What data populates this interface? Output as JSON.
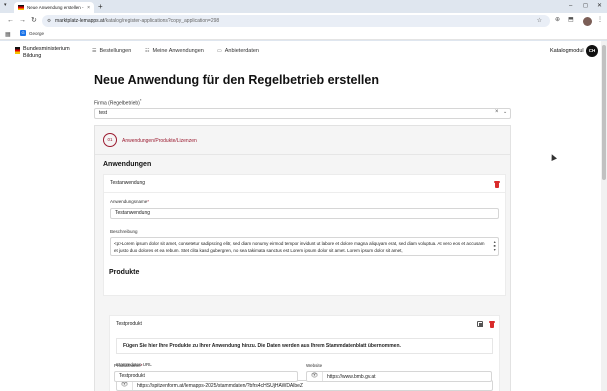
{
  "browser": {
    "tab_title": "Neue Anwendung erstellen - M",
    "tab_close": "×",
    "new_tab": "+",
    "tab_menu": "▾",
    "window_controls": [
      "–",
      "◻",
      "✕"
    ],
    "nav": {
      "back": "←",
      "forward": "→",
      "reload": "↻"
    },
    "site_icon": "⚙",
    "url_host": "marktplatz-lemapps.at",
    "url_path": "/katalog/register-applications?copy_application=298",
    "bookmark_star": "☆",
    "toolbar_icons": [
      "⊕",
      "⬒",
      "⋮"
    ],
    "apps_icon": "▦",
    "bookmark_letter": "G",
    "bookmark_label": "George"
  },
  "header": {
    "logo_line1": "Bundesministerium",
    "logo_line2": "Bildung",
    "nav": [
      {
        "icon": "☰",
        "label": "Bestellungen"
      },
      {
        "icon": "☷",
        "label": "Meine Anwendungen"
      },
      {
        "icon": "▭",
        "label": "Anbieterdaten"
      }
    ],
    "user_label": "Katalogmodul",
    "user_initials": "CH"
  },
  "page": {
    "title": "Neue Anwendung für den Regelbetrieb erstellen",
    "firma_label": "Firma (Regelbetrieb)",
    "required_mark": "*",
    "firma_value": "test",
    "clear_icon": "×",
    "chevron_icon": "⌄"
  },
  "stepper": {
    "number": "01",
    "label": "Anwendungen/Produkte/Lizenzen"
  },
  "anwendungen": {
    "heading": "Anwendungen",
    "item_title": "Testanwendung",
    "name_label": "Anwendungsname",
    "name_value": "Testanwendung",
    "desc_label": "Beschreibung",
    "desc_value": "<p>Lorem ipsum dolor sit amet, consetetur sadipscing elitr, sed diam nonumy eirmod tempor invidunt ut labore et dolore magna aliquyam erat, sed diam voluptua. At vero eos et accusam et justo duo dolores et ea rebum. Stet clita kasd gubergren, no sea takimata sanctus est Lorem ipsum dolor sit amet. Lorem ipsum dolor sit amet,",
    "scroll_up": "▲",
    "scroll_thumb": "■",
    "scroll_down": "▼"
  },
  "produkte": {
    "heading": "Produkte",
    "item_title": "Testprodukt",
    "hint": "Fügen Sie hier Ihre Produkte zu Ihrer Anwendung hinzu. Die Daten werden aus Ihrem Stammdatenblatt übernommen.",
    "stamm_label": "Stammdaten URL",
    "stamm_note_pre": "Bitte geben Sie hier Ihre ",
    "stamm_note_link": "Stammdaten URL",
    "stamm_note_post": " aus der Anbieter Zertifizierung an.",
    "stamm_value": "https://spitzenform.at/lemapps-2025/stammdaten/?bfrs4cHSUjHAWDAlbeZ",
    "produktname_label": "Produktname",
    "produktname_value": "Testprodukt",
    "website_label": "Website",
    "website_value": "https://www.bmb.gv.at",
    "eye_icon": "👁"
  }
}
